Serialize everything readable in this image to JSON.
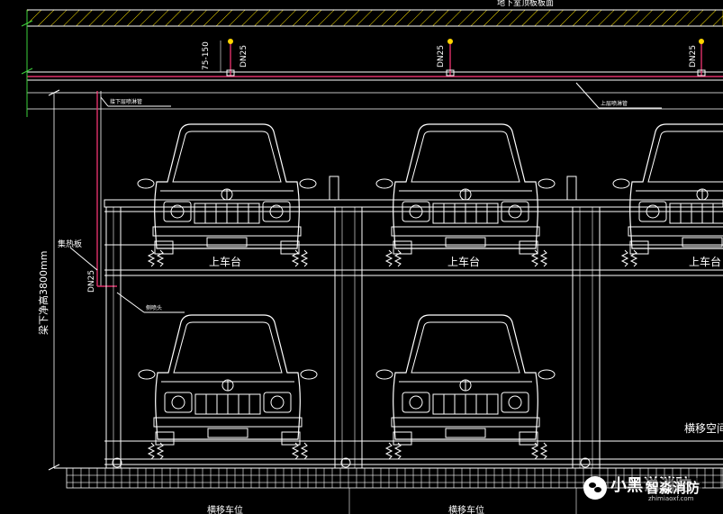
{
  "colors": {
    "background": "#000000",
    "lines": "#ffffff",
    "pipe": "#e0306a",
    "dimension": "#3cd23c",
    "accent": "#ffd400"
  },
  "labels": {
    "top_note": "地下室顶板板面",
    "dim_150": "75-150",
    "dn25": "DN25",
    "riser_note": "接下层喷淋管",
    "branch_note": "上层喷淋管",
    "height_dim": "梁下净高3800mm",
    "collector": "集热板",
    "sidewall": "侧喷头",
    "platform": "上车台",
    "translation_space": "横移空间",
    "bottom_left": "横移车位",
    "bottom_right": "横移车位"
  },
  "watermark": {
    "brand": "小黑说消防",
    "sub": "智淼消防",
    "site": "zhimiaoxf.com"
  }
}
